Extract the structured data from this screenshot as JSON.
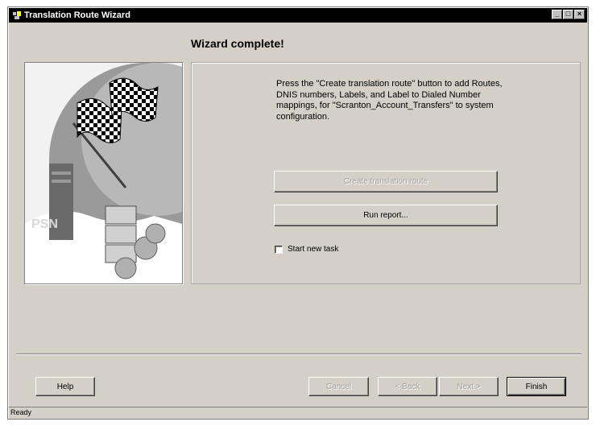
{
  "window": {
    "title": "Translation Route Wizard",
    "icon": "wizard-icon"
  },
  "heading": "Wizard complete!",
  "description": "Press the \"Create translation route\" button to add Routes, DNIS numbers, Labels, and Label to Dialed Number mappings, for \"Scranton_Account_Transfers\" to system configuration.",
  "buttons": {
    "create": "Create translation route",
    "run_report": "Run report...",
    "help": "Help",
    "cancel": "Cancel",
    "back": "< Back",
    "next": "Next >",
    "finish": "Finish"
  },
  "checkbox": {
    "label": "Start new task",
    "checked": false
  },
  "illustration": {
    "psn_label": "PSN"
  },
  "status": "Ready"
}
